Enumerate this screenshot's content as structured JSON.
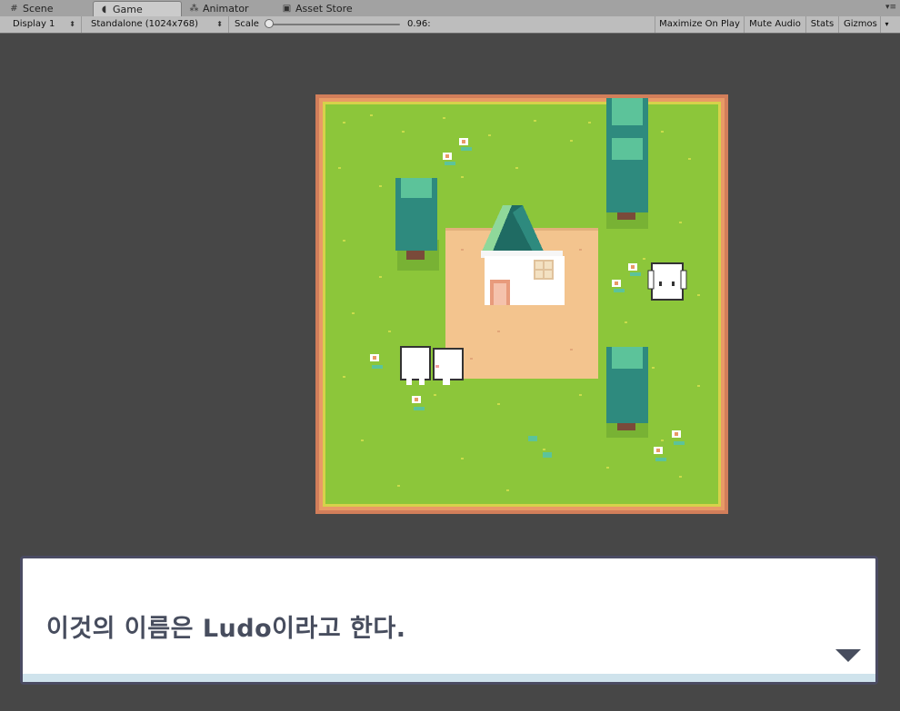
{
  "tabs": [
    {
      "label": "Scene",
      "icon": "grid-icon"
    },
    {
      "label": "Game",
      "icon": "pacman-icon",
      "active": true
    },
    {
      "label": "Animator",
      "icon": "animator-icon"
    },
    {
      "label": "Asset Store",
      "icon": "store-icon"
    }
  ],
  "toolbar": {
    "display": "Display 1",
    "resolution": "Standalone (1024x768)",
    "scale_label": "Scale",
    "scale_value": "0.96:",
    "scale_fraction": 0.0,
    "maximize": "Maximize On Play",
    "mute": "Mute Audio",
    "stats": "Stats",
    "gizmos": "Gizmos"
  },
  "dialog": {
    "text": "이것의 이름은 Ludo이라고 한다."
  },
  "colors": {
    "grass": "#8cc63a",
    "border": "#d27e5a",
    "dirt": "#f3c48e",
    "tree": "#2e8a7e",
    "roof": "#2f9b7e",
    "dialog_text": "#474d5e"
  }
}
